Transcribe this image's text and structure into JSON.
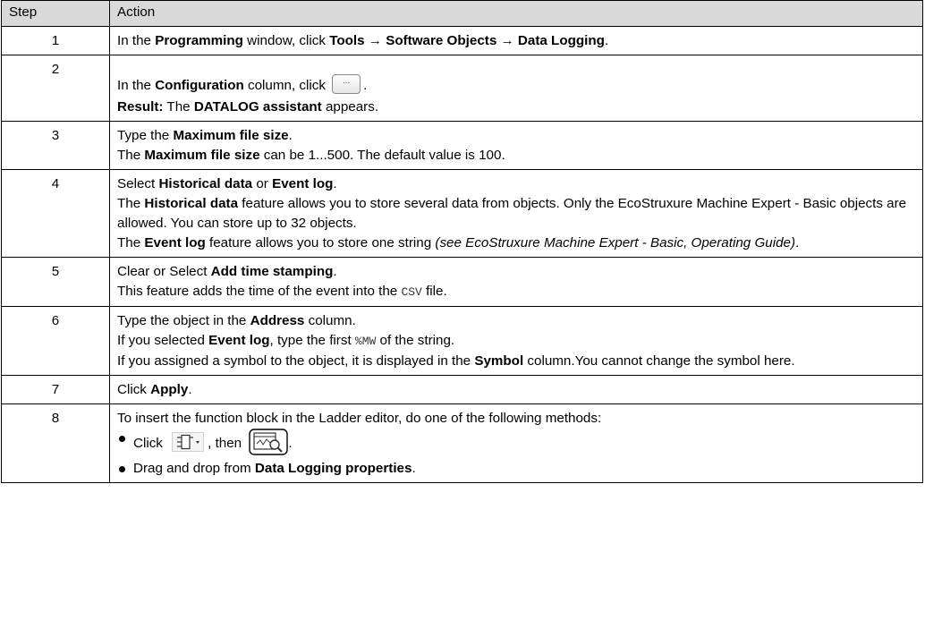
{
  "header": {
    "step": "Step",
    "action": "Action"
  },
  "rows": [
    {
      "step": "1",
      "a1": "In the ",
      "a2": "Programming",
      "a3": " window, click ",
      "a4": "Tools",
      "a5": " → ",
      "a6": "Software Objects",
      "a7": "  → ",
      "a8": "Data Logging",
      "a9": "."
    },
    {
      "step": "2",
      "a1": "In the ",
      "a2": "Configuration",
      "a3": " column, click ",
      "button_label": "...",
      "a4": ".",
      "r1": "Result:",
      "r2": " The ",
      "r3": "DATALOG assistant",
      "r4": " appears."
    },
    {
      "step": "3",
      "a1": "Type the ",
      "a2": "Maximum file size",
      "a3": ".",
      "b1": "The ",
      "b2": "Maximum file size",
      "b3": " can be 1...500. The default value is 100."
    },
    {
      "step": "4",
      "a1": "Select ",
      "a2": "Historical data",
      "a3": " or ",
      "a4": "Event log",
      "a5": ".",
      "b1": "The ",
      "b2": "Historical data",
      "b3": " feature allows you to store several data from objects. Only the EcoStruxure Machine Expert - Basic objects are allowed. You can store up to 32 objects.",
      "c1": "The ",
      "c2": "Event log",
      "c3": " feature allows you to store one string ",
      "c4": "(see EcoStruxure Machine Expert - Basic, Operating Guide)",
      "c5": "."
    },
    {
      "step": "5",
      "a1": "Clear or Select ",
      "a2": "Add time stamping",
      "a3": ".",
      "b1": "This feature adds the time of the event into the ",
      "b2": "CSV",
      "b3": " file."
    },
    {
      "step": "6",
      "a1": "Type the object in the ",
      "a2": "Address",
      "a3": " column.",
      "b1": "If you selected ",
      "b2": "Event log",
      "b3": ", type the first ",
      "b4": "%MW",
      "b5": " of the string.",
      "c1": "If you assigned a symbol to the object, it is displayed in the ",
      "c2": "Symbol",
      "c3": " column.You cannot change the symbol here."
    },
    {
      "step": "7",
      "a1": "Click ",
      "a2": "Apply",
      "a3": "."
    },
    {
      "step": "8",
      "a1": "To insert the function block in the Ladder editor, do one of the following methods:",
      "m1a": "Click ",
      "m1b": ", then ",
      "m1c": ".",
      "m2a": "Drag and drop from ",
      "m2b": "Data Logging properties",
      "m2c": "."
    }
  ],
  "icons": {
    "button": "ellipsis-button-icon",
    "toolbar": "function-block-dropdown-icon",
    "datalog": "data-logging-function-block-icon"
  },
  "colors": {
    "header_bg": "#d9d9d9",
    "border": "#000000"
  }
}
